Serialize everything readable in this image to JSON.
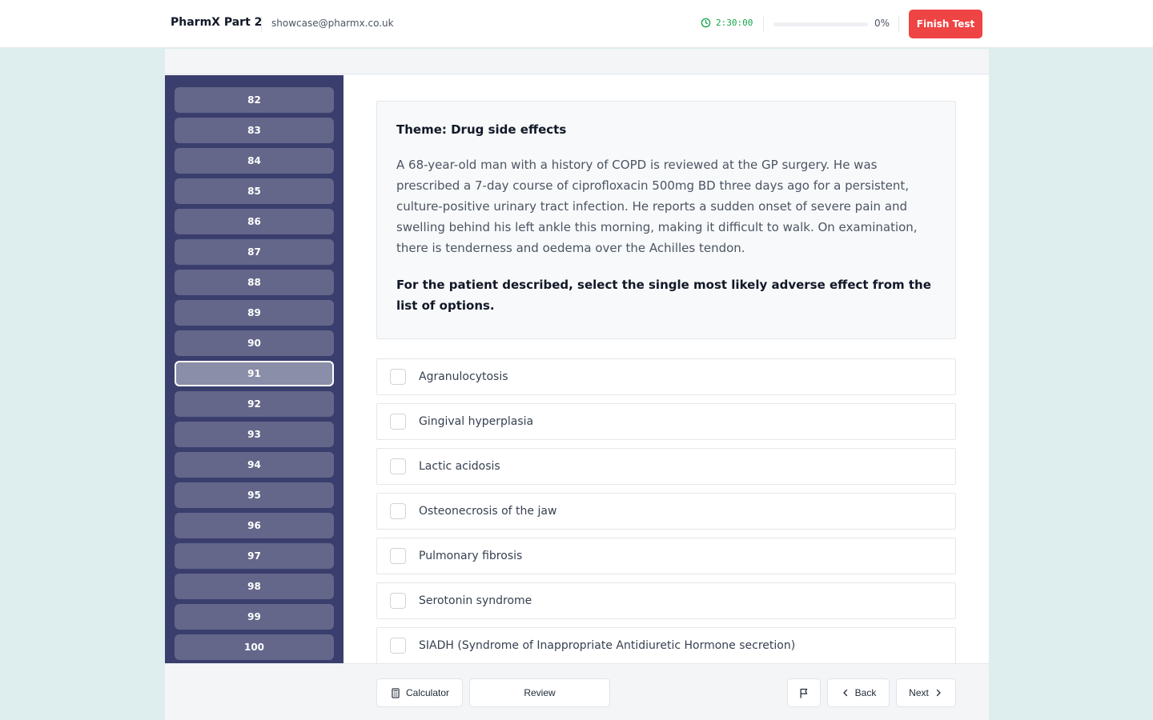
{
  "header": {
    "app_title": "PharmX Part 2",
    "user_email": "showcase@pharmx.co.uk",
    "timer": "2:30:00",
    "progress_percent": 0,
    "progress_text": "0%",
    "finish_label": "Finish Test"
  },
  "question_nav": {
    "items": [
      "82",
      "83",
      "84",
      "85",
      "86",
      "87",
      "88",
      "89",
      "90",
      "91",
      "92",
      "93",
      "94",
      "95",
      "96",
      "97",
      "98",
      "99",
      "100"
    ],
    "current": "91"
  },
  "question": {
    "theme": "Theme: Drug side effects",
    "stem": "A 68-year-old man with a history of COPD is reviewed at the GP surgery. He was prescribed a 7-day course of ciprofloxacin 500mg BD three days ago for a persistent, culture-positive urinary tract infection. He reports a sudden onset of severe pain and swelling behind his left ankle this morning, making it difficult to walk. On examination, there is tenderness and oedema over the Achilles tendon.",
    "instruction": "For the patient described, select the single most likely adverse effect from the list of options."
  },
  "options": [
    "Agranulocytosis",
    "Gingival hyperplasia",
    "Lactic acidosis",
    "Osteonecrosis of the jaw",
    "Pulmonary fibrosis",
    "Serotonin syndrome",
    "SIADH (Syndrome of Inappropriate Antidiuretic Hormone secretion)"
  ],
  "footer": {
    "calculator_label": "Calculator",
    "review_label": "Review",
    "back_label": "Back",
    "next_label": "Next"
  },
  "colors": {
    "accent_danger": "#ef4444",
    "timer_green": "#16a34a",
    "nav_background": "#3a3e6d",
    "nav_button": "#646789",
    "nav_button_current": "#8b8ea8"
  },
  "icons": {
    "timer": "clock-icon",
    "calculator": "calculator-icon",
    "flag": "flag-icon",
    "back": "chevron-left-icon",
    "next": "chevron-right-icon"
  }
}
